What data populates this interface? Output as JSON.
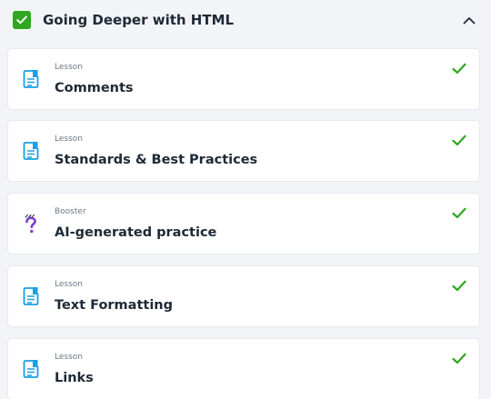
{
  "section": {
    "title": "Going Deeper with HTML",
    "completed": true,
    "expanded": true,
    "accent_color": "#2ea820"
  },
  "items": [
    {
      "kind": "Lesson",
      "title": "Comments",
      "icon": "document-icon",
      "completed": true
    },
    {
      "kind": "Lesson",
      "title": "Standards & Best Practices",
      "icon": "document-icon",
      "completed": true
    },
    {
      "kind": "Booster",
      "title": "AI-generated practice",
      "icon": "question-mark-icon",
      "completed": true
    },
    {
      "kind": "Lesson",
      "title": "Text Formatting",
      "icon": "document-icon",
      "completed": true
    },
    {
      "kind": "Lesson",
      "title": "Links",
      "icon": "document-icon",
      "completed": true
    }
  ],
  "colors": {
    "lesson_icon": "#1a9fe0",
    "booster_icon": "#7b3fd1",
    "check": "#2ea820"
  }
}
